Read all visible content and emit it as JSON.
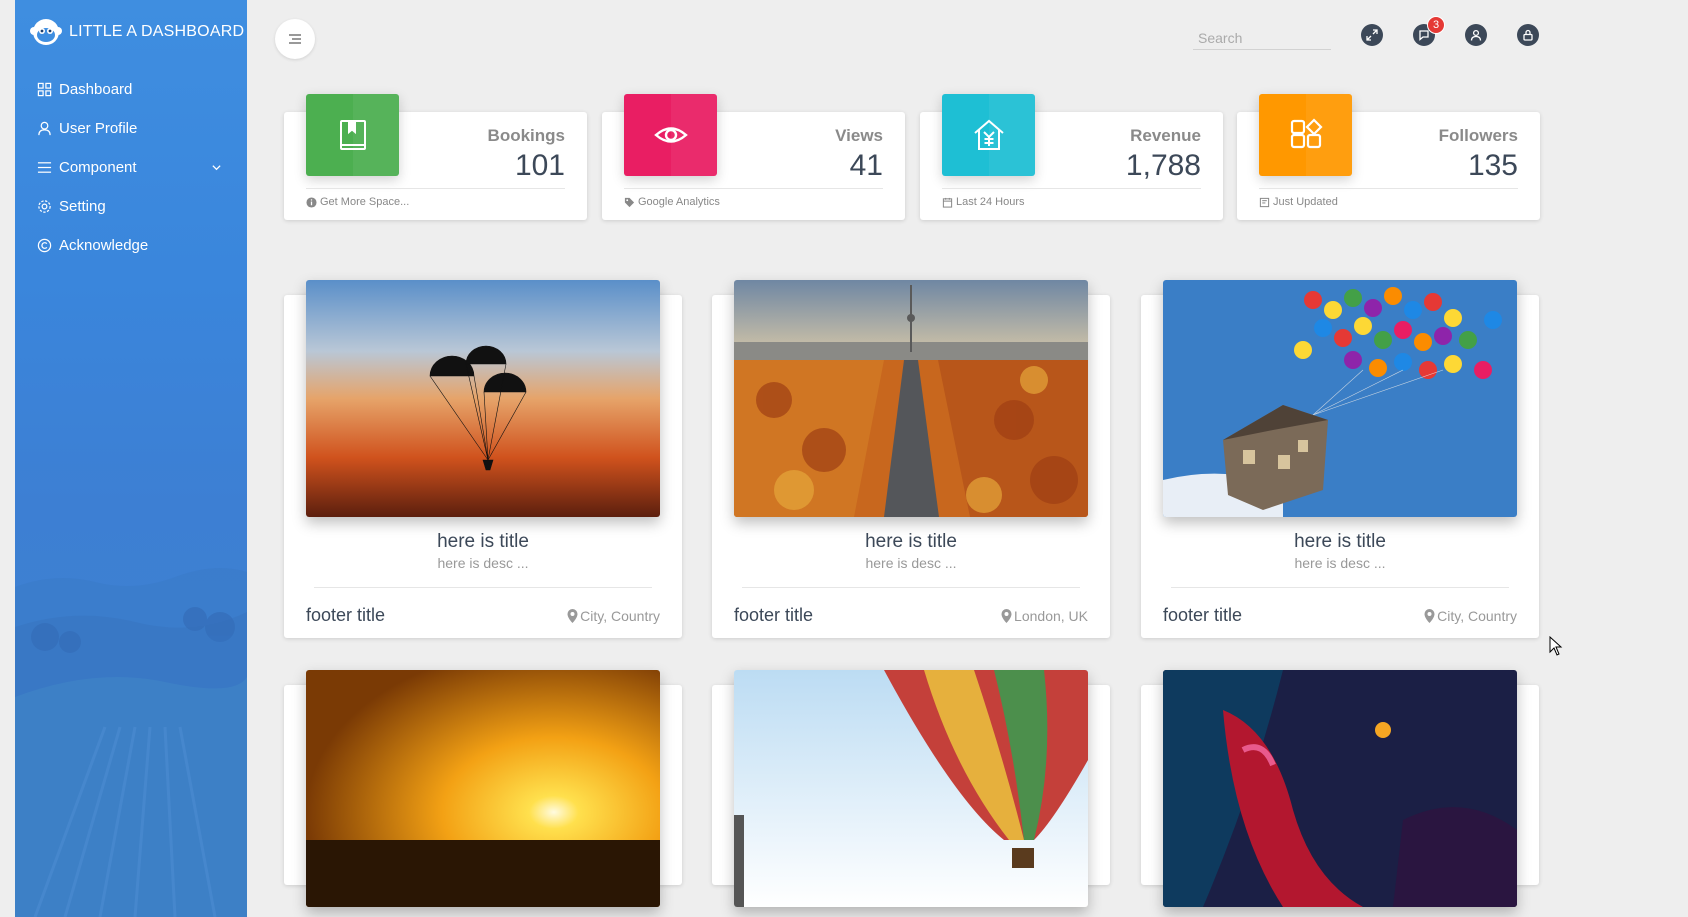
{
  "brand": {
    "title": "LITTLE A DASHBOARD",
    "logo_icon": "monkey-logo"
  },
  "sidebar": {
    "items": [
      {
        "label": "Dashboard",
        "icon": "grid-icon"
      },
      {
        "label": "User Profile",
        "icon": "user-icon"
      },
      {
        "label": "Component",
        "icon": "list-icon",
        "expandable": true
      },
      {
        "label": "Setting",
        "icon": "gear-icon"
      },
      {
        "label": "Acknowledge",
        "icon": "copyright-icon"
      }
    ]
  },
  "topbar": {
    "search_placeholder": "Search",
    "notification_count": "3",
    "icons": [
      "fullscreen-icon",
      "notification-icon",
      "user-icon",
      "lock-icon"
    ]
  },
  "stats": [
    {
      "label": "Bookings",
      "value": "101",
      "footer": "Get More Space...",
      "color": "#4caf50",
      "icon": "book-icon",
      "footer_icon": "info-icon"
    },
    {
      "label": "Views",
      "value": "41",
      "footer": "Google Analytics",
      "color": "#e91e63",
      "icon": "eye-icon",
      "footer_icon": "tag-icon"
    },
    {
      "label": "Revenue",
      "value": "1,788",
      "footer": "Last 24 Hours",
      "color": "#00bcd4",
      "icon": "money-house-icon",
      "footer_icon": "calendar-icon"
    },
    {
      "label": "Followers",
      "value": "135",
      "footer": "Just Updated",
      "color": "#ff9800",
      "icon": "apps-icon",
      "footer_icon": "update-icon"
    }
  ],
  "cards": [
    {
      "title": "here is title",
      "desc": "here is desc ...",
      "footer_title": "footer title",
      "location": "City, Country"
    },
    {
      "title": "here is title",
      "desc": "here is desc ...",
      "footer_title": "footer title",
      "location": "London, UK"
    },
    {
      "title": "here is title",
      "desc": "here is desc ...",
      "footer_title": "footer title",
      "location": "City, Country"
    }
  ]
}
